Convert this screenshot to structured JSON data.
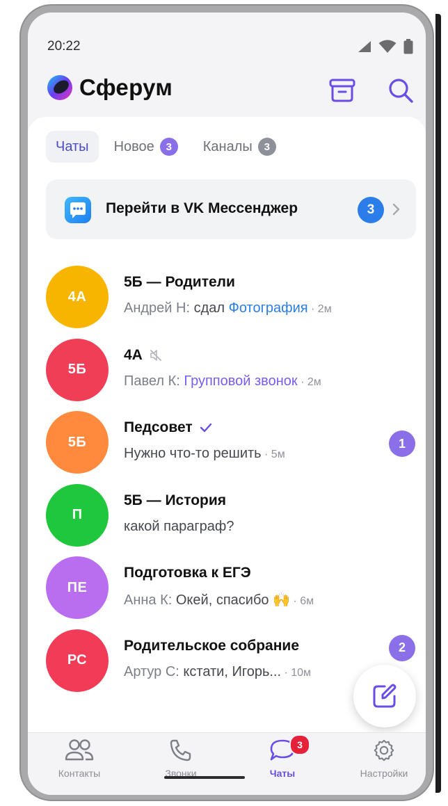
{
  "status_bar": {
    "time": "20:22"
  },
  "app": {
    "title": "Сферум",
    "archive_icon": "archive-icon",
    "search_icon": "search-icon"
  },
  "tabs": [
    {
      "label": "Чаты",
      "active": true
    },
    {
      "label": "Новое",
      "badge": "3",
      "badge_color": "#8a6fe8"
    },
    {
      "label": "Каналы",
      "badge": "3",
      "badge_color": "#8e9199"
    }
  ],
  "vk_banner": {
    "label": "Перейти в VK Мессенджер",
    "badge": "3"
  },
  "chats": [
    {
      "initials": "4A",
      "color": "#f7b500",
      "title": "5Б — Родители",
      "sender": "Андрей Н: ",
      "message": "сдал ",
      "link": "Фотография",
      "time": " · 2м"
    },
    {
      "initials": "5Б",
      "color": "#f03e56",
      "title": "4А",
      "sender": "Павел К: ",
      "link": "Групповой звонок",
      "time": " · 2м",
      "muted": true
    },
    {
      "initials": "5Б",
      "color": "#ff8a3d",
      "title": "Педсовет",
      "message": "Нужно что-то решить",
      "time": " · 5м",
      "unread": "1",
      "verified": true
    },
    {
      "initials": "П",
      "color": "#1ec73b",
      "title": "5Б — История",
      "message": "какой параграф?"
    },
    {
      "initials": "ПЕ",
      "color": "#b96ef0",
      "title": "Подготовка к ЕГЭ",
      "sender": "Анна К: ",
      "message": "Окей, спасибо 🙌",
      "time": " · 6м"
    },
    {
      "initials": "РС",
      "color": "#f23b57",
      "title": "Родительское собрание",
      "sender": "Артур С: ",
      "message": "кстати, Игорь...",
      "time": " · 10м",
      "unread": "2"
    }
  ],
  "bottom_nav": [
    {
      "label": "Контакты",
      "icon": "contacts-icon"
    },
    {
      "label": "Звонки",
      "icon": "phone-icon"
    },
    {
      "label": "Чаты",
      "icon": "chat-bubble-icon",
      "active": true,
      "badge": "3"
    },
    {
      "label": "Настройки",
      "icon": "gear-icon"
    }
  ],
  "fab": {
    "icon": "compose-icon"
  }
}
